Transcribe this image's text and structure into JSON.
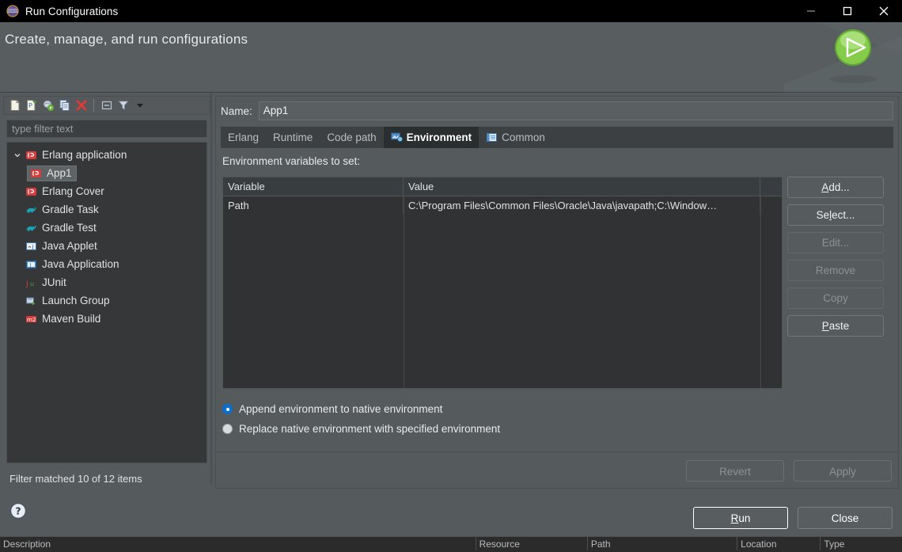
{
  "window": {
    "title": "Run Configurations",
    "icon": "erlang-eclipse-icon",
    "controls": {
      "minimize": "minimize-icon",
      "maximize": "maximize-icon",
      "close": "close-icon"
    }
  },
  "header": {
    "title": "Create, manage, and run configurations",
    "decoration_icon": "run-play-icon"
  },
  "tree_toolbar": {
    "buttons": [
      {
        "name": "new-configuration-icon",
        "title": "New launch configuration"
      },
      {
        "name": "new-prototype-icon",
        "title": "New prototype"
      },
      {
        "name": "export-configuration-icon",
        "title": "Export"
      },
      {
        "name": "duplicate-configuration-icon",
        "title": "Duplicate"
      },
      {
        "name": "delete-configuration-icon",
        "title": "Delete"
      },
      {
        "name": "collapse-all-icon",
        "title": "Collapse All"
      },
      {
        "name": "filter-icon",
        "title": "Filter"
      },
      {
        "name": "view-menu-icon",
        "title": "View Menu"
      }
    ]
  },
  "filter": {
    "placeholder": "type filter text",
    "value": "",
    "status": "Filter matched 10 of 12 items"
  },
  "tree": {
    "items": [
      {
        "label": "Erlang application",
        "icon": "erlang-icon",
        "level": 0,
        "expanded": true,
        "selected": false
      },
      {
        "label": "App1",
        "icon": "erlang-icon",
        "level": 1,
        "expanded": null,
        "selected": true
      },
      {
        "label": "Erlang Cover",
        "icon": "erlang-icon",
        "level": 0,
        "expanded": null,
        "selected": false
      },
      {
        "label": "Gradle Task",
        "icon": "gradle-icon",
        "level": 0,
        "expanded": null,
        "selected": false
      },
      {
        "label": "Gradle Test",
        "icon": "gradle-icon",
        "level": 0,
        "expanded": null,
        "selected": false
      },
      {
        "label": "Java Applet",
        "icon": "java-applet-icon",
        "level": 0,
        "expanded": null,
        "selected": false
      },
      {
        "label": "Java Application",
        "icon": "java-application-icon",
        "level": 0,
        "expanded": null,
        "selected": false
      },
      {
        "label": "JUnit",
        "icon": "junit-icon",
        "level": 0,
        "expanded": null,
        "selected": false
      },
      {
        "label": "Launch Group",
        "icon": "launch-group-icon",
        "level": 0,
        "expanded": null,
        "selected": false
      },
      {
        "label": "Maven Build",
        "icon": "maven-icon",
        "level": 0,
        "expanded": null,
        "selected": false
      }
    ]
  },
  "config": {
    "name_label": "Name:",
    "name_value": "App1",
    "tabs": [
      {
        "label": "Erlang",
        "icon": null,
        "active": false
      },
      {
        "label": "Runtime",
        "icon": null,
        "active": false
      },
      {
        "label": "Code path",
        "icon": null,
        "active": false
      },
      {
        "label": "Environment",
        "icon": "environment-icon",
        "active": true
      },
      {
        "label": "Common",
        "icon": "common-icon",
        "active": false
      }
    ]
  },
  "environment": {
    "section_label": "Environment variables to set:",
    "columns": [
      "Variable",
      "Value"
    ],
    "rows": [
      {
        "variable": "Path",
        "value": "C:\\Program Files\\Common Files\\Oracle\\Java\\javapath;C:\\Window…"
      }
    ],
    "buttons": [
      {
        "label": "Add...",
        "mnemonic": "A",
        "enabled": true
      },
      {
        "label": "Select...",
        "mnemonic": "l",
        "enabled": true
      },
      {
        "label": "Edit...",
        "mnemonic": "",
        "enabled": false
      },
      {
        "label": "Remove",
        "mnemonic": "",
        "enabled": false
      },
      {
        "label": "Copy",
        "mnemonic": "",
        "enabled": false
      },
      {
        "label": "Paste",
        "mnemonic": "P",
        "enabled": true
      }
    ],
    "radios": [
      {
        "label": "Append environment to native environment",
        "mnemonic": "A",
        "selected": true
      },
      {
        "label": "Replace native environment with specified environment",
        "mnemonic": "p",
        "selected": false
      }
    ]
  },
  "panel_buttons": [
    {
      "label": "Revert",
      "enabled": false
    },
    {
      "label": "Apply",
      "enabled": false
    }
  ],
  "footer": {
    "help_icon": "help-icon",
    "buttons": [
      {
        "label": "Run",
        "mnemonic": "R",
        "default": true
      },
      {
        "label": "Close",
        "mnemonic": "",
        "default": false
      }
    ]
  },
  "background": {
    "table_headers": [
      "Description",
      "Resource",
      "Path",
      "Location",
      "Type"
    ]
  },
  "colors": {
    "titlebar": "#000000",
    "header_band": "#585e60",
    "dialog": "#555a5c",
    "tree_bg": "#353739",
    "table_bg": "#303233",
    "accent_blue": "#0b6ed1",
    "erlang_red": "#d93a3a",
    "run_green": "#7dc242"
  }
}
